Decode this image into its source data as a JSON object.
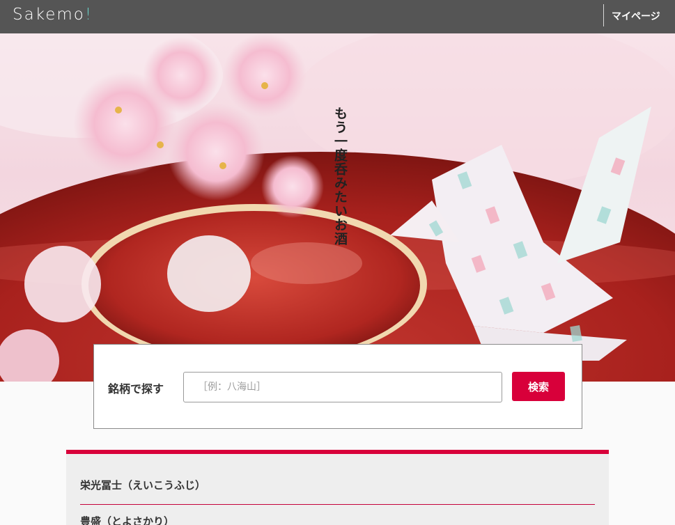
{
  "header": {
    "logo_text": "Sakemo",
    "logo_mark": "!",
    "mypage_label": "マイページ"
  },
  "hero": {
    "tagline": "もう一度呑みたいお酒"
  },
  "search": {
    "label": "銘柄で探す",
    "placeholder": "［例：八海山］",
    "button_label": "検索"
  },
  "results": [
    {
      "label": "栄光冨士（えいこうふじ）"
    },
    {
      "label": "豊盛（とよさかり）"
    }
  ],
  "colors": {
    "header_bg": "#555555",
    "accent": "#d8003a",
    "logo_mark": "#69d3c9"
  }
}
